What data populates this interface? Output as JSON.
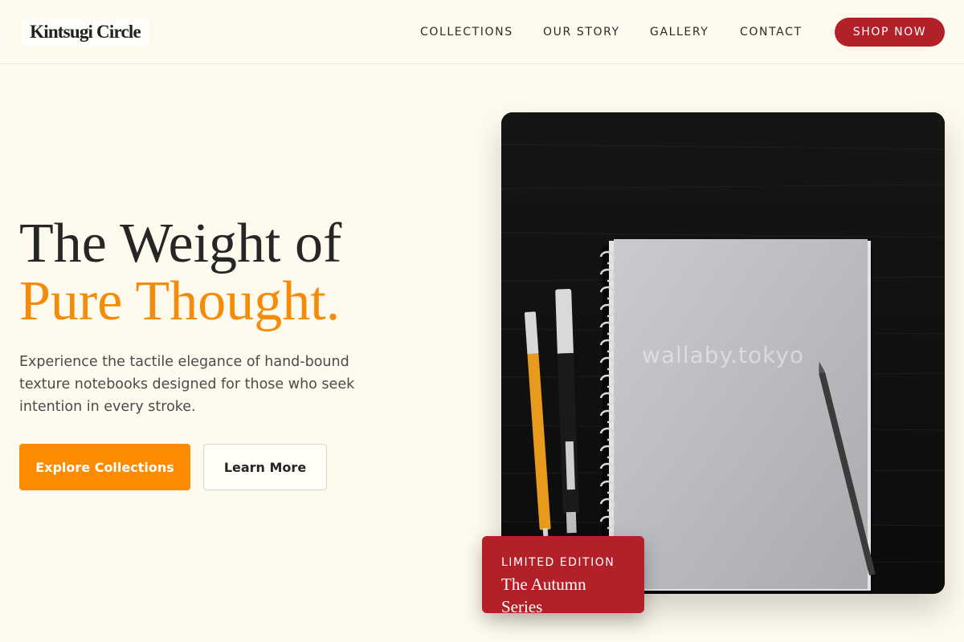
{
  "brand": {
    "name": "Kintsugi Circle"
  },
  "nav": {
    "links": [
      "COLLECTIONS",
      "OUR STORY",
      "GALLERY",
      "CONTACT"
    ],
    "cta": "SHOP NOW"
  },
  "hero": {
    "title_line1": "The Weight of",
    "title_line2": "Pure Thought.",
    "description": "Experience the tactile elegance of hand-bound texture notebooks designed for those who seek intention in every stroke.",
    "primary_button": "Explore Collections",
    "secondary_button": "Learn More",
    "image_watermark": "wallaby.tokyo",
    "badge": {
      "eyebrow": "LIMITED EDITION",
      "title": "The Autumn Series"
    }
  },
  "colors": {
    "background": "#fefaed",
    "accent_orange": "#ff8c00",
    "accent_red": "#b32128",
    "text_dark": "#262626"
  }
}
